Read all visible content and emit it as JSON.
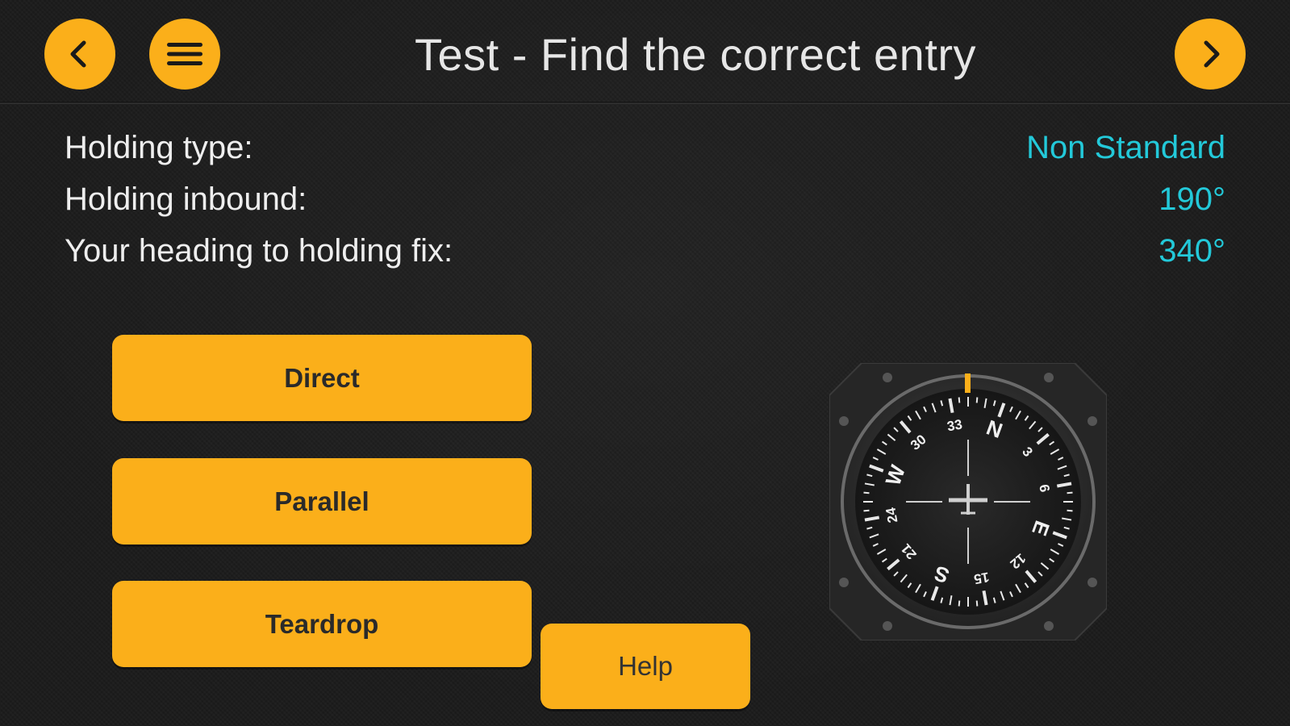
{
  "header": {
    "title": "Test - Find the correct entry",
    "back_icon": "chevron-left-icon",
    "menu_icon": "hamburger-menu-icon",
    "next_icon": "chevron-right-icon"
  },
  "info": {
    "rows": [
      {
        "label": "Holding type:",
        "value": "Non Standard"
      },
      {
        "label": "Holding inbound:",
        "value": "190°"
      },
      {
        "label": "Your heading to holding fix:",
        "value": "340°"
      }
    ]
  },
  "answers": {
    "direct": "Direct",
    "parallel": "Parallel",
    "teardrop": "Teardrop"
  },
  "help": {
    "label": "Help"
  },
  "compass": {
    "heading_deg": 340,
    "card_labels": [
      "N",
      "3",
      "6",
      "E",
      "12",
      "15",
      "S",
      "21",
      "24",
      "W",
      "30",
      "33"
    ]
  },
  "colors": {
    "accent": "#fbaf1a",
    "value_text": "#23c9d9",
    "background": "#1b1b1b"
  }
}
